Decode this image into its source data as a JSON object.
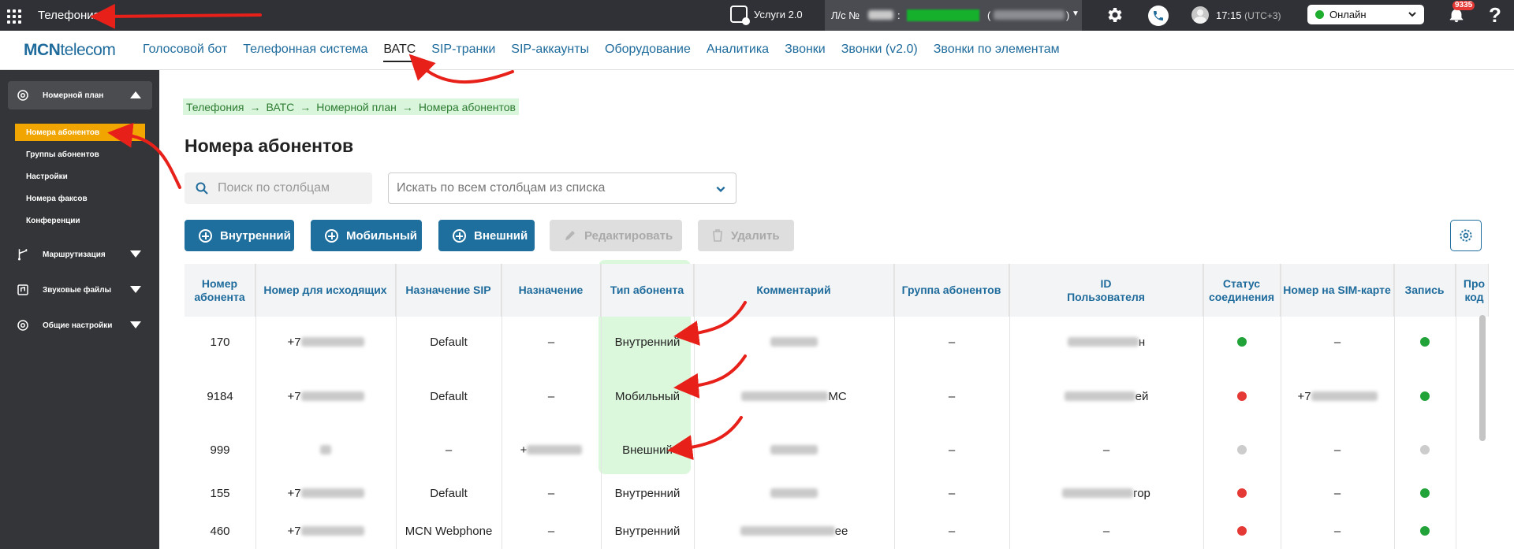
{
  "topbar": {
    "app_title": "Телефония",
    "services_label": "Услуги 2.0",
    "account_prefix": "Л/с №",
    "account_colon": ":",
    "account_paren_open": "(",
    "account_paren_close": ")",
    "time": "17:15",
    "timezone": "(UTC+3)",
    "status_selected": "Онлайн",
    "notifications_count": "9335",
    "help": "?"
  },
  "nav": {
    "logo_mcn": "MCN",
    "logo_telecom": "telecom",
    "links": [
      "Голосовой бот",
      "Телефонная система",
      "ВАТС",
      "SIP-транки",
      "SIP-аккаунты",
      "Оборудование",
      "Аналитика",
      "Звонки",
      "Звонки (v2.0)",
      "Звонки по элементам"
    ],
    "active": "ВАТС"
  },
  "sidebar": {
    "groups": [
      "Номерной план",
      "Маршрутизация",
      "Звуковые файлы",
      "Общие настройки"
    ],
    "items": [
      "Номера абонентов",
      "Группы абонентов",
      "Настройки",
      "Номера факсов",
      "Конференции"
    ],
    "active_item": "Номера абонентов"
  },
  "breadcrumb": [
    "Телефония",
    "ВАТС",
    "Номерной план",
    "Номера абонентов"
  ],
  "breadcrumb_sep": "→",
  "page_title": "Номера абонентов",
  "search": {
    "placeholder": "Поиск по столбцам"
  },
  "filter": {
    "placeholder": "Искать по всем столбцам из списка"
  },
  "buttons": {
    "internal": "Внутренний",
    "mobile": "Мобильный",
    "external": "Внешний",
    "edit": "Редактировать",
    "delete": "Удалить"
  },
  "table": {
    "headers": [
      "Номер абонента",
      "Номер для исходящих",
      "Назначение SIP",
      "Назначение",
      "Тип абонента",
      "Комментарий",
      "Группа абонентов",
      "ID Пользователя",
      "Статус соединения",
      "Номер на SIM-карте",
      "Запись",
      "Про код"
    ],
    "rows": [
      {
        "number": "170",
        "outgoing_prefix": "+7",
        "sip": "Default",
        "dest": "–",
        "type": "Внутренний",
        "comment_suffix": "",
        "group": "–",
        "user_suffix": "н",
        "status": "#22a33a",
        "sim": "–",
        "record": "#22a33a"
      },
      {
        "number": "9184",
        "outgoing_prefix": "+7",
        "sip": "Default",
        "dest": "–",
        "type": "Мобильный",
        "comment_suffix": "МС",
        "group": "–",
        "user_suffix": "ей",
        "status": "#e53935",
        "sim": "+7",
        "record": "#22a33a"
      },
      {
        "number": "999",
        "outgoing_prefix": "",
        "sip": "–",
        "dest": "+",
        "type": "Внешний",
        "comment_suffix": "",
        "group": "–",
        "user_suffix": "–",
        "status": "#cccccc",
        "sim": "–",
        "record": "#cccccc"
      },
      {
        "number": "155",
        "outgoing_prefix": "+7",
        "sip": "Default",
        "dest": "–",
        "type": "Внутренний",
        "comment_suffix": "",
        "group": "–",
        "user_suffix": "гор",
        "status": "#e53935",
        "sim": "–",
        "record": "#22a33a"
      },
      {
        "number": "460",
        "outgoing_prefix": "+7",
        "sip": "MCN Webphone",
        "dest": "–",
        "type": "Внутренний",
        "comment_suffix": "ее",
        "group": "–",
        "user_suffix": "–",
        "status": "#e53935",
        "sim": "–",
        "record": "#22a33a"
      }
    ]
  },
  "colors": {
    "accent": "#1e6b9c",
    "button": "#1f6f9e",
    "sidebar": "#333538",
    "topbar": "#2f3136",
    "active_item": "#f0a500",
    "annotation": "#e8201a"
  }
}
